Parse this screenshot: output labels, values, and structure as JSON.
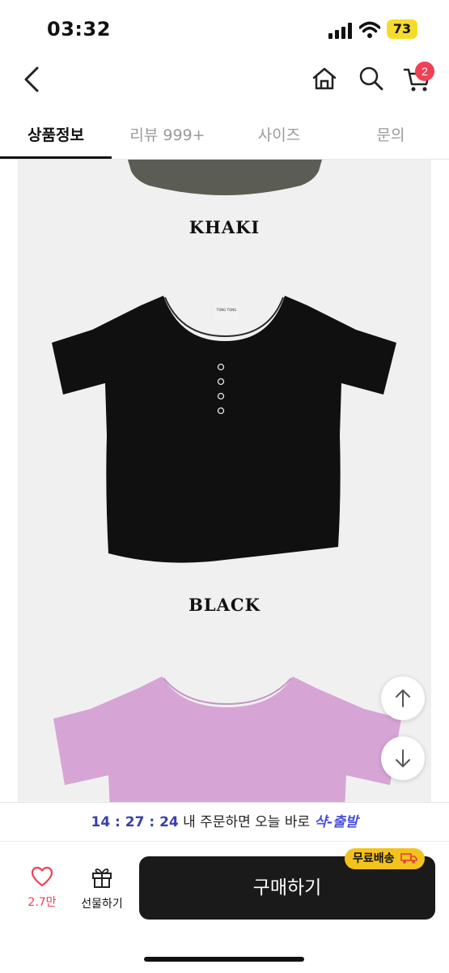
{
  "status_bar": {
    "time": "03:32",
    "battery": "73"
  },
  "header": {
    "cart_count": "2"
  },
  "tabs": [
    {
      "label": "상품정보",
      "active": true
    },
    {
      "label": "리뷰 999+",
      "active": false
    },
    {
      "label": "사이즈",
      "active": false
    },
    {
      "label": "문의",
      "active": false
    }
  ],
  "content": {
    "colors": [
      "KHAKI",
      "BLACK"
    ],
    "shirt_tag": "TONG TONG"
  },
  "promo": {
    "timer": "14 : 27 : 24",
    "text": " 내 주문하면 오늘 바로 ",
    "ship_label": "샥-출발"
  },
  "bottom_bar": {
    "like_count": "2.7만",
    "gift_label": "선물하기",
    "buy_label": "구매하기",
    "free_shipping": "무료배송"
  },
  "colors": {
    "accent_red": "#ef4055",
    "badge_yellow": "#f4c21f",
    "buy_button": "#1a1a1a",
    "timer_blue": "#3b3fa8"
  },
  "icons": [
    "back-arrow-icon",
    "home-icon",
    "search-icon",
    "cart-icon",
    "scroll-up-icon",
    "scroll-down-icon",
    "heart-icon",
    "gift-icon",
    "truck-icon"
  ]
}
